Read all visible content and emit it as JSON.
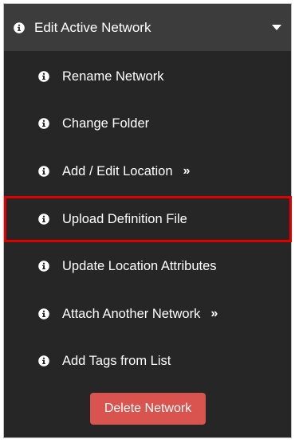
{
  "header": {
    "title": "Edit Active Network",
    "icon": "info-circle-icon",
    "caret_icon": "caret-down-icon"
  },
  "menu": {
    "items": [
      {
        "label": "Rename Network",
        "icon": "info-circle-icon"
      },
      {
        "label": "Change Folder",
        "icon": "info-circle-icon"
      },
      {
        "label": "Add / Edit Location",
        "icon": "info-circle-icon",
        "more": "»"
      },
      {
        "label": "Upload Definition File",
        "icon": "info-circle-icon",
        "highlighted": true
      },
      {
        "label": "Update Location Attributes",
        "icon": "info-circle-icon"
      },
      {
        "label": "Attach Another Network",
        "icon": "info-circle-icon",
        "more": "»"
      },
      {
        "label": "Add Tags from List",
        "icon": "info-circle-icon"
      }
    ]
  },
  "delete_button": {
    "label": "Delete Network"
  },
  "colors": {
    "panel_bg": "#262626",
    "header_bg": "#3c3c3c",
    "text": "#ffffff",
    "highlight_border": "#e00000",
    "danger": "#d9534f"
  }
}
